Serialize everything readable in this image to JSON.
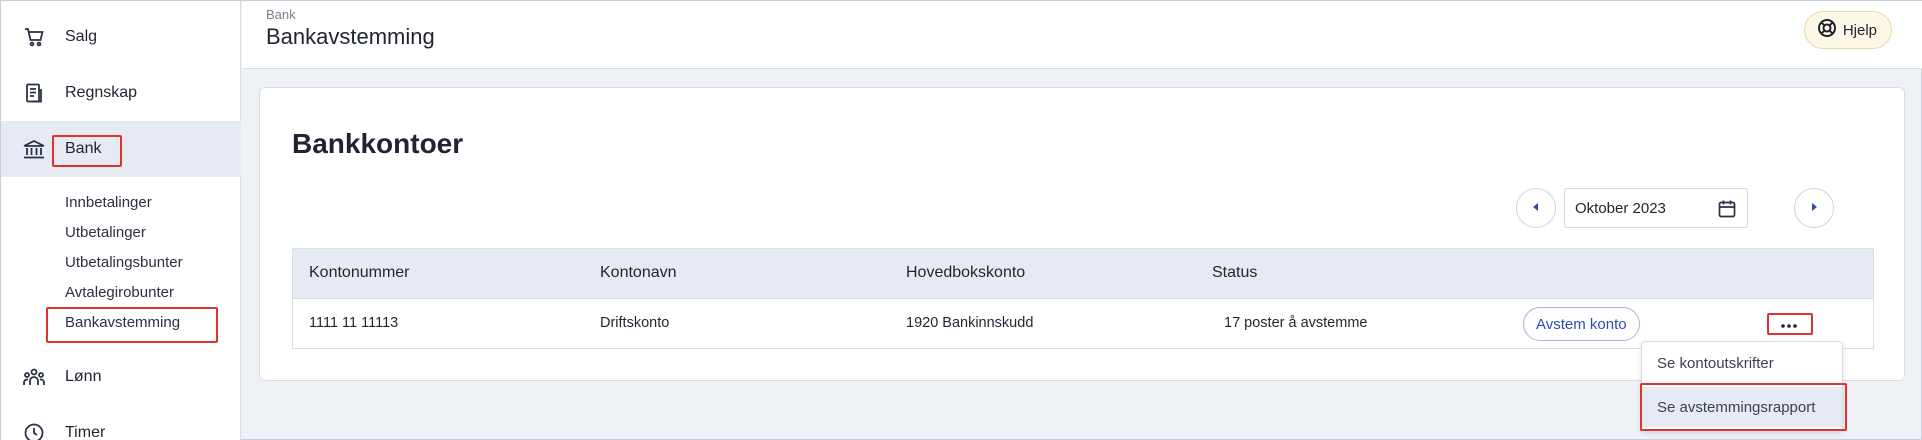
{
  "sidebar": {
    "items": [
      {
        "label": "Salg",
        "icon": "cart-icon"
      },
      {
        "label": "Regnskap",
        "icon": "ledger-icon"
      },
      {
        "label": "Bank",
        "icon": "bank-icon"
      },
      {
        "label": "Lønn",
        "icon": "people-icon"
      },
      {
        "label": "Timer",
        "icon": "clock-icon"
      }
    ],
    "bank_subitems": [
      "Innbetalinger",
      "Utbetalinger",
      "Utbetalingsbunter",
      "Avtalegirobunter",
      "Bankavstemming"
    ]
  },
  "header": {
    "breadcrumb": "Bank",
    "title": "Bankavstemming",
    "help_label": "Hjelp"
  },
  "main": {
    "title": "Bankkontoer",
    "period": "Oktober 2023",
    "table": {
      "columns": [
        "Kontonummer",
        "Kontonavn",
        "Hovedbokskonto",
        "Status"
      ],
      "rows": [
        {
          "account_number": "1111 11 11113",
          "account_name": "Driftskonto",
          "ledger_account": "1920 Bankinnskudd",
          "status": "17 poster å avstemme",
          "action": "Avstem konto"
        }
      ]
    },
    "menu": [
      "Se kontoutskrifter",
      "Se avstemmingsrapport"
    ]
  },
  "colors": {
    "highlight": "#e0302f",
    "accent": "#2b4eb0",
    "active_bg": "#e6eaf2"
  }
}
